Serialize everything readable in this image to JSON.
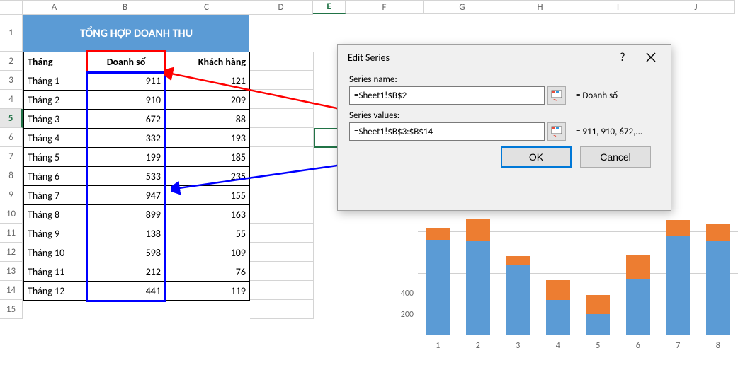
{
  "columns": [
    "A",
    "B",
    "C",
    "D",
    "E",
    "F",
    "G",
    "H",
    "I",
    "J"
  ],
  "title": "TỔNG HỢP DOANH THU",
  "headers": {
    "thang": "Tháng",
    "doanhso": "Doanh số",
    "khachhang": "Khách hàng"
  },
  "rows": [
    {
      "thang": "Tháng 1",
      "doanhso": 911,
      "khach": 121
    },
    {
      "thang": "Tháng 2",
      "doanhso": 910,
      "khach": 209
    },
    {
      "thang": "Tháng 3",
      "doanhso": 672,
      "khach": 88
    },
    {
      "thang": "Tháng 4",
      "doanhso": 332,
      "khach": 193
    },
    {
      "thang": "Tháng 5",
      "doanhso": 199,
      "khach": 185
    },
    {
      "thang": "Tháng 6",
      "doanhso": 533,
      "khach": 235
    },
    {
      "thang": "Tháng 7",
      "doanhso": 947,
      "khach": 155
    },
    {
      "thang": "Tháng 8",
      "doanhso": 899,
      "khach": 163
    },
    {
      "thang": "Tháng 9",
      "doanhso": 138,
      "khach": 55
    },
    {
      "thang": "Tháng 10",
      "doanhso": 598,
      "khach": 109
    },
    {
      "thang": "Tháng 11",
      "doanhso": 212,
      "khach": 76
    },
    {
      "thang": "Tháng 12",
      "doanhso": 441,
      "khach": 119
    }
  ],
  "active_row_label": "5",
  "dialog": {
    "title": "Edit Series",
    "help": "?",
    "name_label": "Series name:",
    "name_value": "=Sheet1!$B$2",
    "name_preview": "= Doanh số",
    "values_label": "Series values:",
    "values_value": "=Sheet1!$B$3:$B$14",
    "values_preview": "= 911, 910, 672,...",
    "ok": "OK",
    "cancel": "Cancel"
  },
  "chart_data": {
    "type": "bar",
    "stacked": true,
    "xlabel": "",
    "ylabel": "",
    "ylim": [
      0,
      1200
    ],
    "yticks_visible": [
      200,
      400
    ],
    "x_visible": [
      1,
      2,
      3,
      4,
      5,
      6,
      7,
      8
    ],
    "series": [
      {
        "name": "Doanh số",
        "color": "#5b9bd5",
        "values": [
          911,
          910,
          672,
          332,
          199,
          533,
          947,
          899
        ]
      },
      {
        "name": "Khách hàng",
        "color": "#ed7d31",
        "values": [
          121,
          209,
          88,
          193,
          185,
          235,
          155,
          163
        ]
      }
    ]
  }
}
